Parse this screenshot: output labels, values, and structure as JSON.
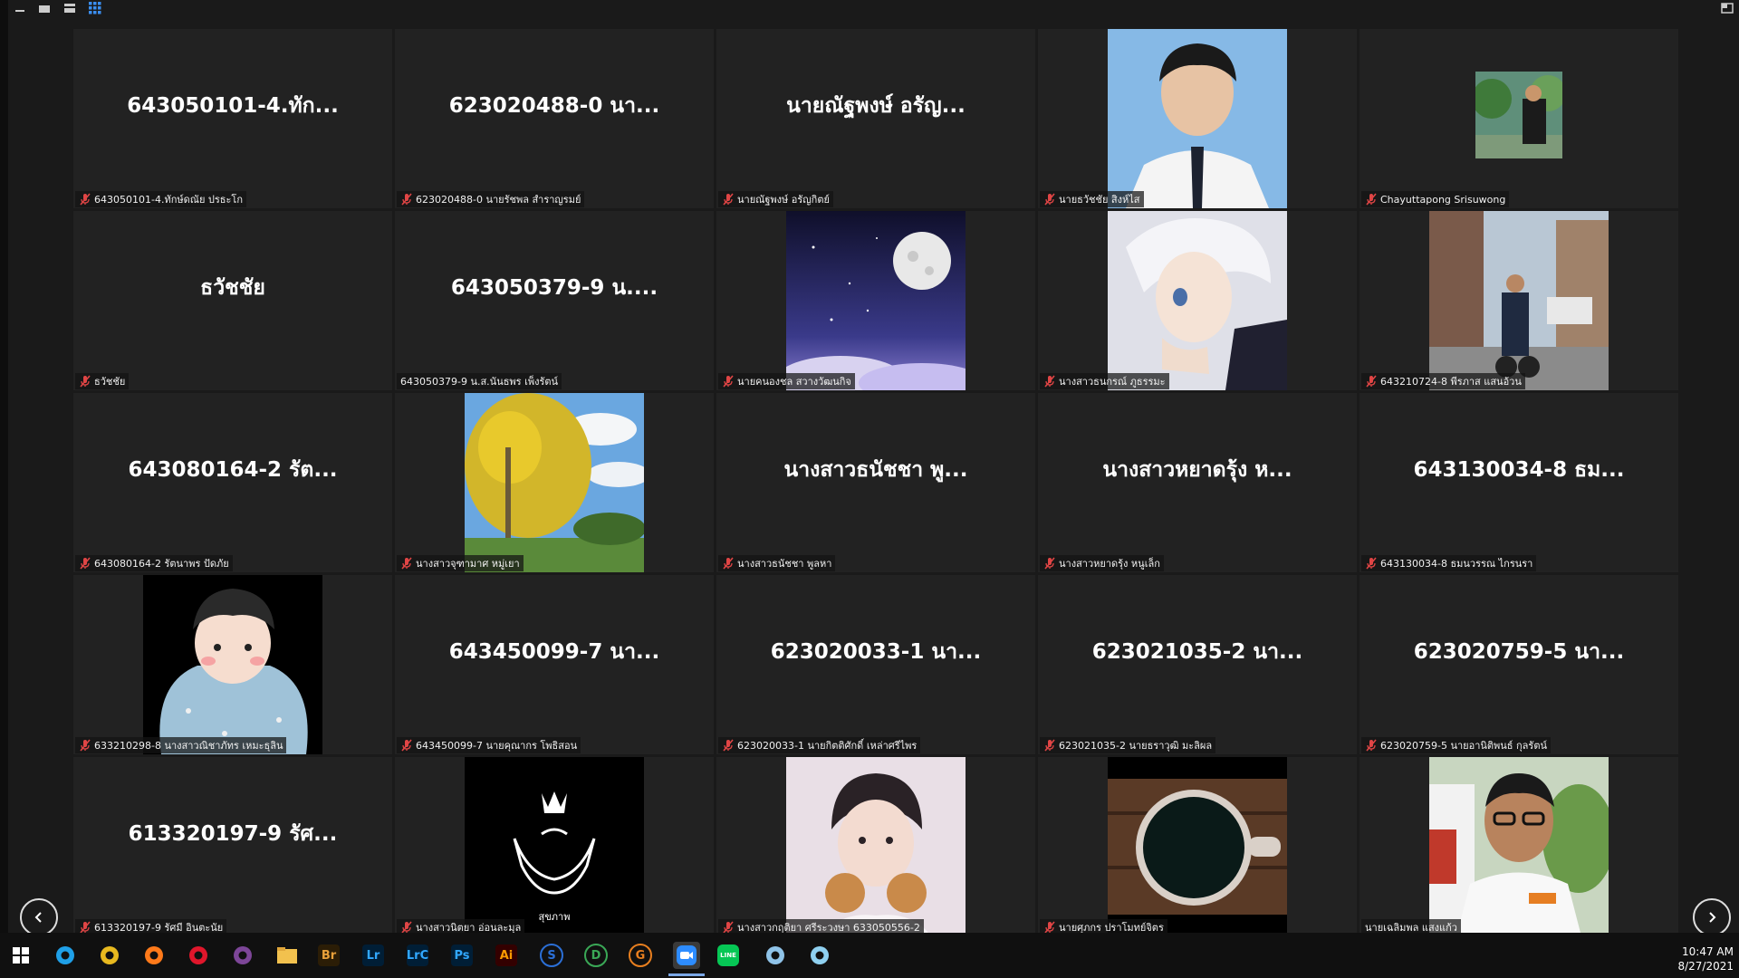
{
  "view_modes": [
    "minimize-view",
    "speaker-view",
    "gallery-strip-view",
    "gallery-view"
  ],
  "participants": [
    {
      "display": "643050101-4.ทัก...",
      "name": "643050101-4.ทักษ์ดณัย ปรธะโก",
      "kind": "text"
    },
    {
      "display": "623020488-0 นา...",
      "name": "623020488-0 นายรัชพล สำราญรมย์",
      "kind": "text"
    },
    {
      "display": "นายณัฐพงษ์ อรัญ...",
      "name": "นายณัฐพงษ์ อรัญกิตย์",
      "kind": "text"
    },
    {
      "display": "",
      "name": "นายธวัชชัย สิงห์ไส",
      "kind": "photo",
      "photo": "id-portrait"
    },
    {
      "display": "",
      "name": "Chayuttapong Srisuwong",
      "kind": "photo-small",
      "photo": "tree-man"
    },
    {
      "display": "ธวัชชัย",
      "name": "ธวัชชัย",
      "kind": "text"
    },
    {
      "display": "643050379-9 น....",
      "name": "643050379-9 น.ส.นันธพร เพ็งรัตน์",
      "kind": "text"
    },
    {
      "display": "",
      "name": "นายคนองชล สวางวัฒนกิจ",
      "kind": "photo",
      "photo": "moon-sky"
    },
    {
      "display": "",
      "name": "นางสาวธนกรณ์ ภูธรรมะ",
      "kind": "photo",
      "photo": "anime-boy"
    },
    {
      "display": "",
      "name": "643210724-8 พีรภาส แสนอ้วน",
      "kind": "photo",
      "photo": "street"
    },
    {
      "display": "643080164-2 รัต...",
      "name": "643080164-2 รัตนาพร ปัดภัย",
      "kind": "text"
    },
    {
      "display": "",
      "name": "นางสาวจุฑามาศ หมู่เยา",
      "kind": "photo",
      "photo": "yellow-tree"
    },
    {
      "display": "นางสาวธนัชชา พู...",
      "name": "นางสาวธนัชชา พูลหา",
      "kind": "text"
    },
    {
      "display": "นางสาวหยาดรุ้ง ห...",
      "name": "นางสาวหยาดรุ้ง หนูเล็ก",
      "kind": "text"
    },
    {
      "display": "643130034-8 ธม...",
      "name": "643130034-8 ธมนวรรณ ไกรนรา",
      "kind": "text"
    },
    {
      "display": "",
      "name": "633210298-8 นางสาวณิชาภัทร เหมะธุลิน",
      "kind": "photo",
      "photo": "cartoon-blanket"
    },
    {
      "display": "643450099-7 นา...",
      "name": "643450099-7 นายคุณากร โพธิสอน",
      "kind": "text"
    },
    {
      "display": "623020033-1 นา...",
      "name": "623020033-1 นายกิตติศักดิ์ เหล่าศรีไพร",
      "kind": "text"
    },
    {
      "display": "623021035-2 นา...",
      "name": "623021035-2 นายธราวุฒิ มะลิผล",
      "kind": "text"
    },
    {
      "display": "623020759-5 นา...",
      "name": "623020759-5 นายอานิติพนธ์ กุลรัตน์",
      "kind": "text"
    },
    {
      "display": "613320197-9 รัศ...",
      "name": "613320197-9 รัศมี อินตะนัย",
      "kind": "text"
    },
    {
      "display": "",
      "name": "นางสาวนิตยา อ่อนละมุล",
      "kind": "photo",
      "photo": "dark-logo"
    },
    {
      "display": "",
      "name": "นางสาวกฤติยา ศรีระวงษา 633050556-2",
      "kind": "photo",
      "photo": "pink-boy"
    },
    {
      "display": "",
      "name": "นายศุภกร ปราโมทย์จิตร",
      "kind": "photo",
      "photo": "coffee-cup"
    },
    {
      "display": "",
      "name": "นายเฉลิมพล แสงแก้ว",
      "kind": "photo",
      "photo": "glasses-man"
    }
  ],
  "photo_texts": {
    "dark-logo": "สุขภาพ"
  },
  "clock": {
    "time": "10:47 AM",
    "date": "8/27/2021"
  },
  "taskbar": [
    {
      "name": "windows-start-icon",
      "label": "",
      "color": "#ffffff"
    },
    {
      "name": "edge-icon",
      "label": "",
      "color": "#1fa0e8"
    },
    {
      "name": "chrome-icon",
      "label": "",
      "color": "#e8b91f"
    },
    {
      "name": "firefox-icon",
      "label": "",
      "color": "#ff7a1a"
    },
    {
      "name": "opera-icon",
      "label": "",
      "color": "#e0162b"
    },
    {
      "name": "tor-browser-icon",
      "label": "",
      "color": "#7d4698"
    },
    {
      "name": "file-explorer-icon",
      "label": "",
      "color": "#f2c14e"
    },
    {
      "name": "bridge-icon",
      "label": "Br",
      "color": "#2b1d06"
    },
    {
      "name": "lightroom-icon",
      "label": "Lr",
      "color": "#001e36"
    },
    {
      "name": "lightroom-classic-icon",
      "label": "LrC",
      "color": "#001e36"
    },
    {
      "name": "photoshop-icon",
      "label": "Ps",
      "color": "#001e36"
    },
    {
      "name": "illustrator-icon",
      "label": "Ai",
      "color": "#330000"
    },
    {
      "name": "shield-s-icon",
      "label": "S",
      "color": "#2b6fd6"
    },
    {
      "name": "shield-d-icon",
      "label": "D",
      "color": "#3aa856"
    },
    {
      "name": "g-app-icon",
      "label": "G",
      "color": "#e87f1f"
    },
    {
      "name": "zoom-icon",
      "label": "",
      "color": "#2d8cff"
    },
    {
      "name": "line-icon",
      "label": "LINE",
      "color": "#06c755"
    },
    {
      "name": "notes-icon",
      "label": "",
      "color": "#8fc3e8"
    },
    {
      "name": "bird-app-icon",
      "label": "",
      "color": "#8fd0f0"
    }
  ]
}
